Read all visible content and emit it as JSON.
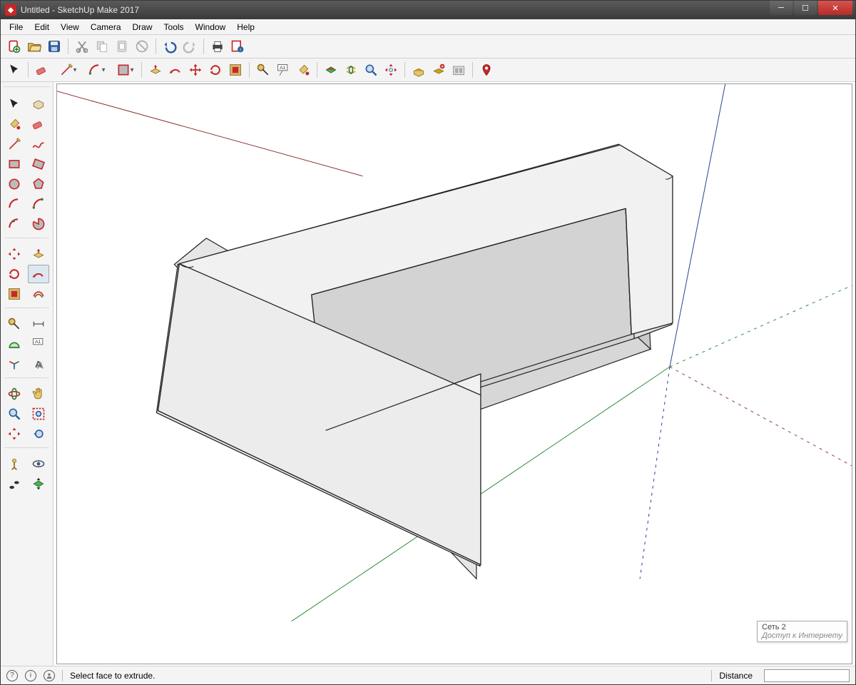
{
  "window": {
    "title": "Untitled - SketchUp Make 2017"
  },
  "menu": {
    "items": [
      "File",
      "Edit",
      "View",
      "Camera",
      "Draw",
      "Tools",
      "Window",
      "Help"
    ]
  },
  "toolbar1_icons": [
    "new-circle-plus",
    "open-folder",
    "save-disk",
    "cut-scissors",
    "copy",
    "paste-clipboard",
    "delete-cancel",
    "undo",
    "redo",
    "print",
    "info-model"
  ],
  "toolbar2_icons": [
    "select-arrow",
    "eraser",
    "pencil",
    "arc",
    "rectangle",
    "push-pull-cube",
    "follow-me",
    "move",
    "rotate",
    "offset",
    "tape-measure",
    "text-label",
    "paint-bucket",
    "section-plane",
    "orbit",
    "zoom",
    "zoom-extents",
    "3d-warehouse-get",
    "3d-warehouse-share",
    "extensions",
    "add-location",
    "ruby"
  ],
  "side_tools": [
    [
      "select-arrow",
      "make-component"
    ],
    [
      "paint-bucket",
      "eraser"
    ],
    [
      "pencil",
      "freehand"
    ],
    [
      "rectangle",
      "rotated-rectangle"
    ],
    [
      "circle",
      "polygon"
    ],
    [
      "arc",
      "arc-2pt"
    ],
    [
      "arc-3pt",
      "pie"
    ],
    [
      "move",
      "push-pull"
    ],
    [
      "rotate",
      "follow-me"
    ],
    [
      "scale",
      "offset"
    ],
    [
      "tape-measure",
      "dimension"
    ],
    [
      "protractor",
      "text-label"
    ],
    [
      "axes",
      "3d-text"
    ],
    [
      "orbit",
      "pan"
    ],
    [
      "zoom",
      "zoom-window"
    ],
    [
      "zoom-extents",
      "previous-view"
    ],
    [
      "position-camera",
      "look-around"
    ],
    [
      "walk",
      "section-plane"
    ]
  ],
  "status": {
    "hint": "Select face to extrude.",
    "measurement_label": "Distance",
    "measurement_value": ""
  },
  "network_tooltip": {
    "line1": "Сеть 2",
    "line2": "Доступ к Интернету"
  },
  "colors": {
    "axis_red": "#8a3a3a",
    "axis_green": "#2f8a3a",
    "axis_blue": "#2a3f9a"
  }
}
